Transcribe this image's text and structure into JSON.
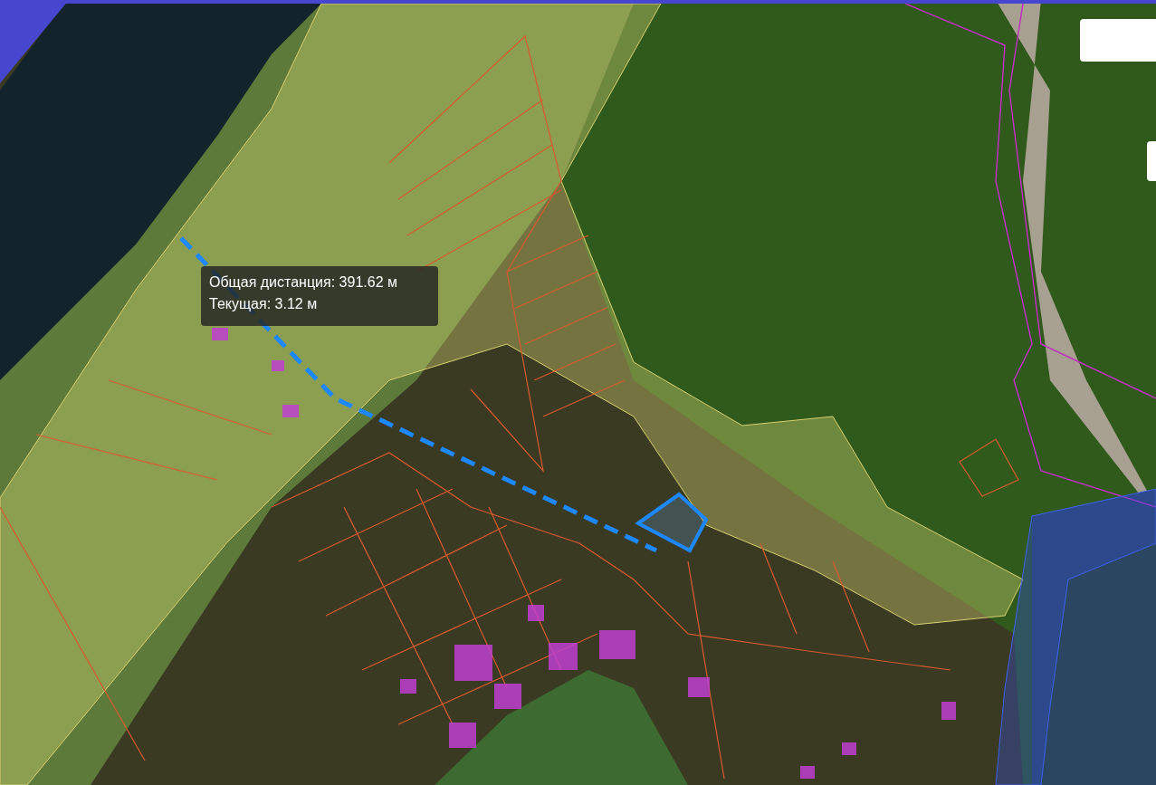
{
  "map": {
    "measurement_tooltip": {
      "total": "Общая дистанция: 391.62 м",
      "current": "Текущая: 3.12 м"
    }
  }
}
